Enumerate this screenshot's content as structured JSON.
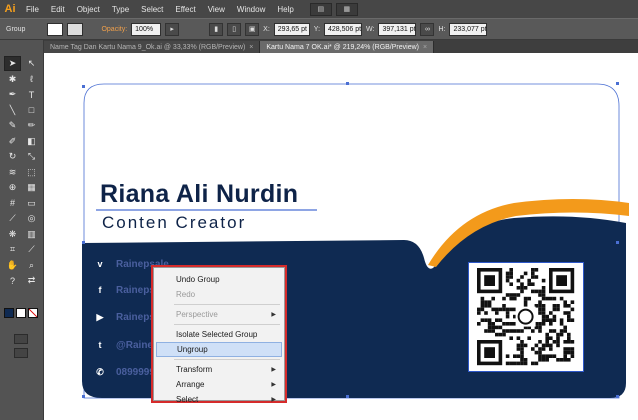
{
  "menubar": {
    "logo": "Ai",
    "items": [
      "File",
      "Edit",
      "Object",
      "Type",
      "Select",
      "Effect",
      "View",
      "Window",
      "Help"
    ]
  },
  "controlbar": {
    "selection": "Group",
    "opacity_label": "Opacity:",
    "opacity_value": "100%",
    "x_label": "X:",
    "x_value": "293,65 pt",
    "y_label": "Y:",
    "y_value": "428,506 pt",
    "w_label": "W:",
    "w_value": "397,131 pt",
    "h_label": "H:",
    "h_value": "233,077 pt"
  },
  "tabs": [
    {
      "label": "Name Tag Dan Kartu Nama 9_Ok.ai @ 33,33% (RGB/Preview)",
      "active": false
    },
    {
      "label": "Kartu Nama 7 OK.ai* @ 219,24% (RGB/Preview)",
      "active": true
    }
  ],
  "card": {
    "name": "Riana Ali Nurdin",
    "role": "Conten Creator",
    "colors": {
      "navy": "#0f2a52",
      "orange": "#f39a1b",
      "white": "#ffffff"
    },
    "social": [
      {
        "icon": "vimeo-icon",
        "glyph": "v",
        "text": "Rainepsale"
      },
      {
        "icon": "facebook-icon",
        "glyph": "f",
        "text": "Rainepsale"
      },
      {
        "icon": "youtube-icon",
        "glyph": "▶",
        "text": "Rainepsale"
      },
      {
        "icon": "twitter-icon",
        "glyph": "t",
        "text": "@Rainepsale"
      },
      {
        "icon": "phone-icon",
        "glyph": "✆",
        "text": "0899999999"
      }
    ]
  },
  "context_menu": {
    "items": [
      {
        "label": "Undo Group",
        "disabled": false,
        "submenu": false
      },
      {
        "label": "Redo",
        "disabled": true,
        "submenu": false
      },
      {
        "sep": true
      },
      {
        "label": "Perspective",
        "disabled": true,
        "submenu": true
      },
      {
        "sep": true
      },
      {
        "label": "Isolate Selected Group",
        "disabled": false,
        "submenu": false
      },
      {
        "label": "Ungroup",
        "disabled": false,
        "submenu": false,
        "hover": true
      },
      {
        "sep": true
      },
      {
        "label": "Transform",
        "disabled": false,
        "submenu": true
      },
      {
        "label": "Arrange",
        "disabled": false,
        "submenu": true
      },
      {
        "label": "Select",
        "disabled": false,
        "submenu": true
      }
    ]
  }
}
